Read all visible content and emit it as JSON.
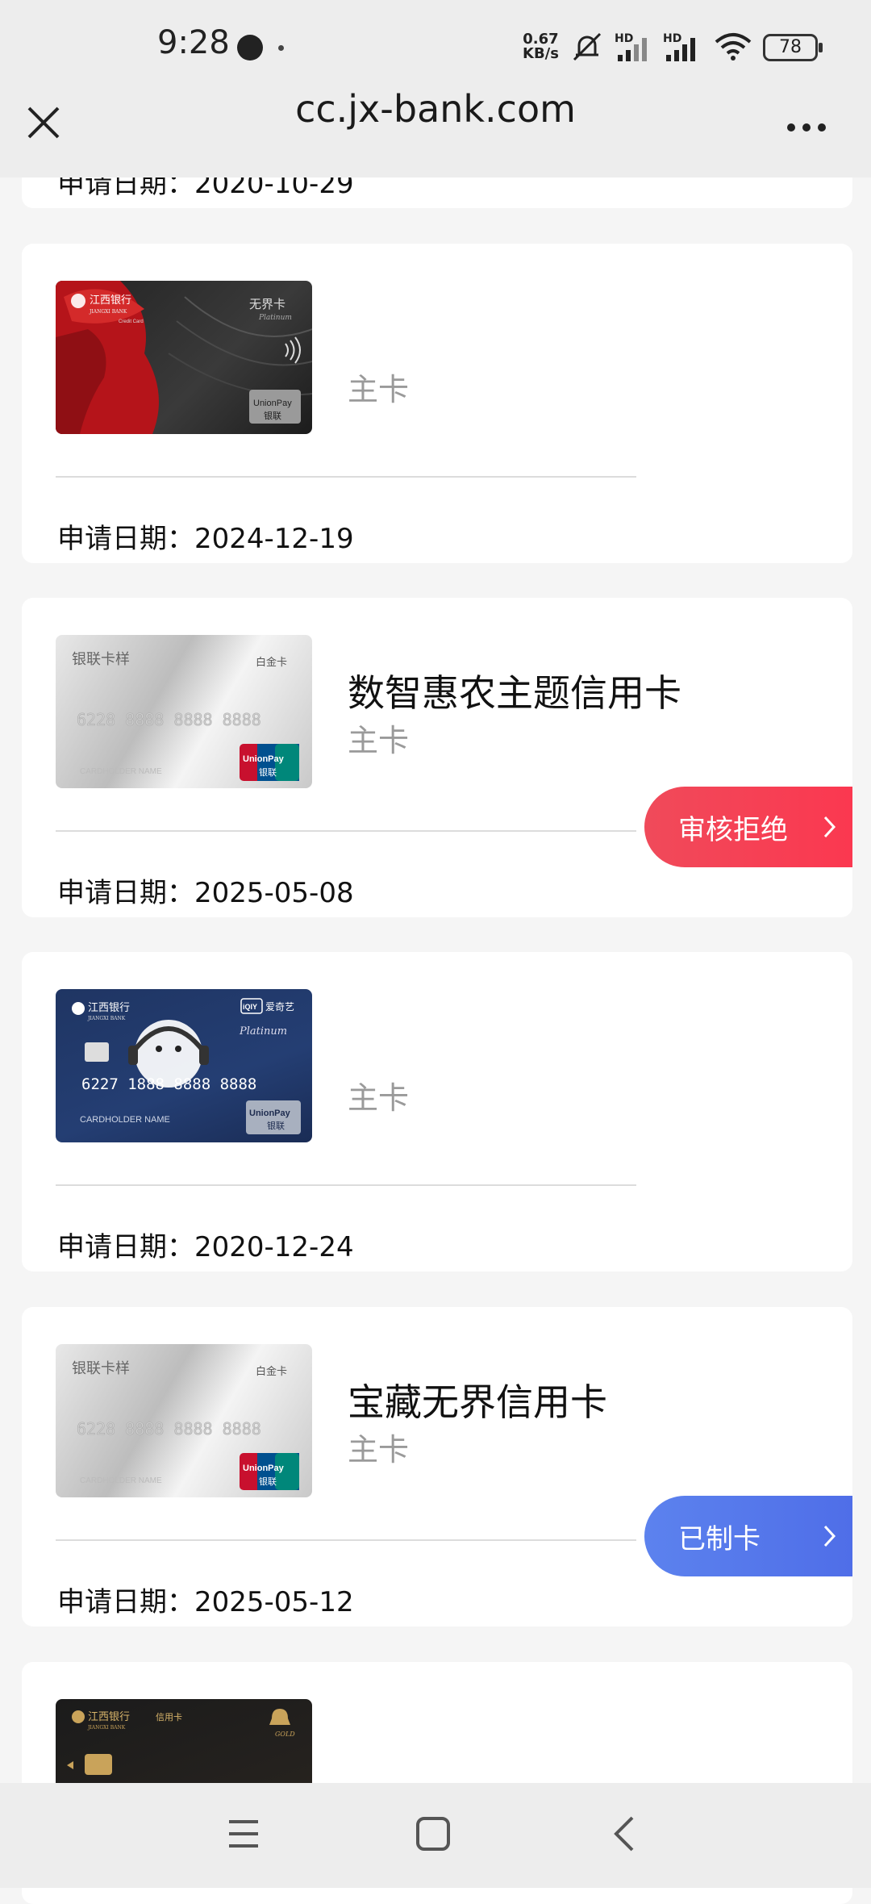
{
  "status_bar": {
    "time": "9:28",
    "net_speed_value": "0.67",
    "net_speed_unit": "KB/s",
    "hd1": "HD",
    "hd2": "HD",
    "battery": "78"
  },
  "header": {
    "url": "cc.jx-bank.com"
  },
  "applications": [
    {
      "name": "",
      "card_type": "",
      "date_label": "申请日期：",
      "date": "2020-10-29",
      "status": ""
    },
    {
      "name": "",
      "card_type": "主卡",
      "date_label": "申请日期：",
      "date": "2024-12-19",
      "status": "",
      "image": {
        "brand": "江西银行",
        "brand_en": "JIANGXI BANK",
        "sub": "Credit Card",
        "tier": "无界卡",
        "tier_en": "Platinum",
        "network": "UnionPay",
        "network_cn": "银联"
      }
    },
    {
      "name": "数智惠农主题信用卡",
      "card_type": "主卡",
      "date_label": "申请日期：",
      "date": "2025-05-08",
      "status": "审核拒绝",
      "image": {
        "brand": "银联卡样",
        "tier": "白金卡",
        "number": "6228 8888 8888 8888",
        "holder": "CARDHOLDER NAME",
        "network": "UnionPay",
        "network_cn": "银联"
      }
    },
    {
      "name": "",
      "card_type": "主卡",
      "date_label": "申请日期：",
      "date": "2020-12-24",
      "status": "",
      "image": {
        "brand": "江西银行",
        "brand_en": "JIANGXI BANK",
        "partner": "爱奇艺",
        "partner_logo": "iQIY",
        "tier_en": "Platinum",
        "number": "6227 1888 8888 8888",
        "holder": "CARDHOLDER NAME",
        "network": "UnionPay",
        "network_cn": "银联"
      }
    },
    {
      "name": "宝藏无界信用卡",
      "card_type": "主卡",
      "date_label": "申请日期：",
      "date": "2025-05-12",
      "status": "已制卡",
      "image": {
        "brand": "银联卡样",
        "tier": "白金卡",
        "number": "6228 8888 8888 8888",
        "holder": "CARDHOLDER NAME",
        "network": "UnionPay",
        "network_cn": "银联"
      }
    },
    {
      "name": "",
      "card_type": "",
      "date_label": "",
      "date": "",
      "status": "",
      "image": {
        "brand": "江西银行",
        "brand_en": "JIANGXI BANK",
        "sub": "信用卡",
        "tier_en": "GOLD"
      }
    }
  ],
  "colors": {
    "status_reject": "#f3435a",
    "status_made": "#5a7cec",
    "page_bg": "#f5f5f5"
  }
}
